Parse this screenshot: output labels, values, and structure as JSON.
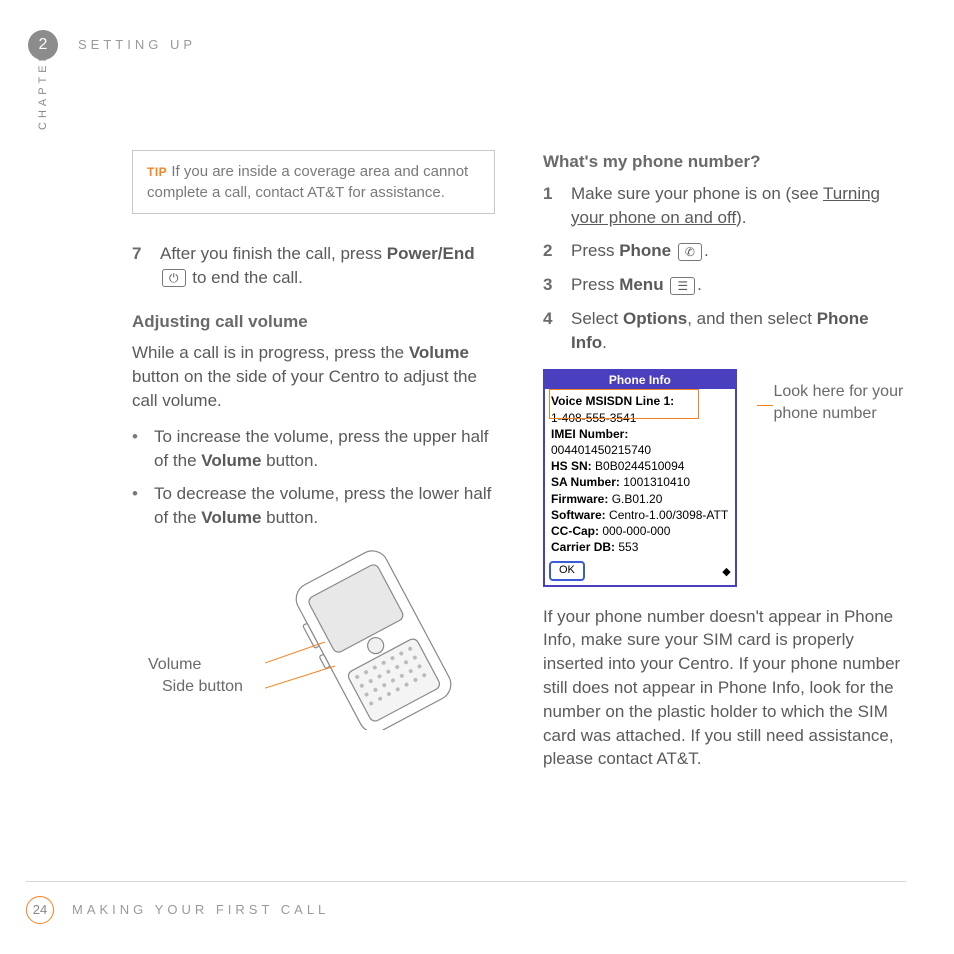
{
  "header": {
    "chapter_number": "2",
    "section_title": "SETTING UP",
    "side_label": "CHAPTER"
  },
  "tip": {
    "label": "TIP",
    "text": "If you are inside a coverage area and cannot complete a call, contact AT&T for assistance."
  },
  "left": {
    "step7_num": "7",
    "step7_a": "After you finish the call, press ",
    "step7_b": "Power/End",
    "step7_c": " to end the call.",
    "power_icon": "⏻",
    "h_adjust": "Adjusting call volume",
    "adjust_p_a": "While a call is in progress, press the ",
    "adjust_p_b": "Volume",
    "adjust_p_c": " button on the side of your Centro to adjust the call volume.",
    "bul1_a": "To increase the volume, press the upper half of the ",
    "bul1_b": "Volume",
    "bul1_c": " button.",
    "bul2_a": "To decrease the volume, press the lower half of the ",
    "bul2_b": "Volume",
    "bul2_c": " button.",
    "illus_label1": "Volume",
    "illus_label2": "Side button"
  },
  "right": {
    "h_whats": "What's my phone number?",
    "s1_num": "1",
    "s1_a": "Make sure your phone is on (see ",
    "s1_link": "Turning your phone on and off",
    "s1_b": ").",
    "s2_num": "2",
    "s2_a": "Press ",
    "s2_b": "Phone",
    "s2_c": ".",
    "phone_icon": "✆",
    "s3_num": "3",
    "s3_a": "Press ",
    "s3_b": "Menu",
    "s3_c": ".",
    "menu_icon": "☰",
    "s4_num": "4",
    "s4_a": "Select ",
    "s4_b": "Options",
    "s4_c": ", and then select ",
    "s4_d": "Phone Info",
    "s4_e": ".",
    "callout": "Look here for your phone number",
    "after_p": "If your phone number doesn't appear in Phone Info, make sure your SIM card is properly inserted into your Centro. If your phone number still does not appear in Phone Info, look for the number on the plastic holder to which the SIM card was attached. If you still need assistance, please contact AT&T."
  },
  "phone_info": {
    "title": "Phone Info",
    "line1_label": "Voice MSISDN Line 1:",
    "line1_value": "1-408-555-3541",
    "imei_label": "IMEI Number:",
    "imei_value": "004401450215740",
    "hssn_label": "HS SN:",
    "hssn_value": "B0B0244510094",
    "sa_label": "SA Number:",
    "sa_value": "1001310410",
    "fw_label": "Firmware:",
    "fw_value": "G.B01.20",
    "sw_label": "Software:",
    "sw_value": "Centro-1.00/3098-ATT",
    "cc_label": "CC-Cap:",
    "cc_value": "000-000-000",
    "cdb_label": "Carrier DB:",
    "cdb_value": "553",
    "ok": "OK"
  },
  "footer": {
    "page": "24",
    "title": "MAKING YOUR FIRST CALL"
  }
}
